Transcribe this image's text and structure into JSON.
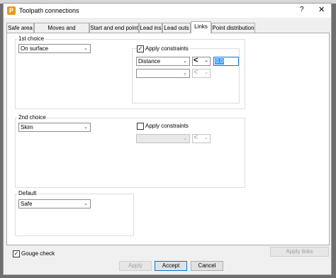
{
  "window": {
    "title": "Toolpath connections",
    "help_label": "?",
    "close_label": "✕"
  },
  "tabs": [
    {
      "label": "Safe area"
    },
    {
      "label": "Moves and clearances"
    },
    {
      "label": "Start and end point"
    },
    {
      "label": "Lead ins"
    },
    {
      "label": "Lead outs"
    },
    {
      "label": "Links"
    },
    {
      "label": "Point distribution"
    }
  ],
  "active_tab": "Links",
  "first_choice": {
    "label": "1st choice",
    "selected": "On surface",
    "constraints": {
      "checked": true,
      "label": "Apply constraints",
      "row1": {
        "type": "Distance",
        "operator": "<",
        "value": "0.0"
      },
      "row2": {
        "type": "",
        "operator": "<"
      }
    }
  },
  "second_choice": {
    "label": "2nd choice",
    "selected": "Skim",
    "constraints": {
      "checked": false,
      "label": "Apply constraints",
      "row1": {
        "type": "",
        "operator": "<"
      }
    }
  },
  "default_choice": {
    "label": "Default",
    "selected": "Safe"
  },
  "gouge_check": {
    "checked": true,
    "label": "Gouge check"
  },
  "buttons": {
    "apply_links": "Apply links",
    "apply": "Apply",
    "accept": "Accept",
    "cancel": "Cancel"
  },
  "icons": {
    "app": "powermill-app-icon",
    "check": "✓",
    "chevron": "⌄"
  },
  "colors": {
    "accent": "#0078d7",
    "selection": "#3399ff",
    "app_icon": "#e89a1d"
  }
}
